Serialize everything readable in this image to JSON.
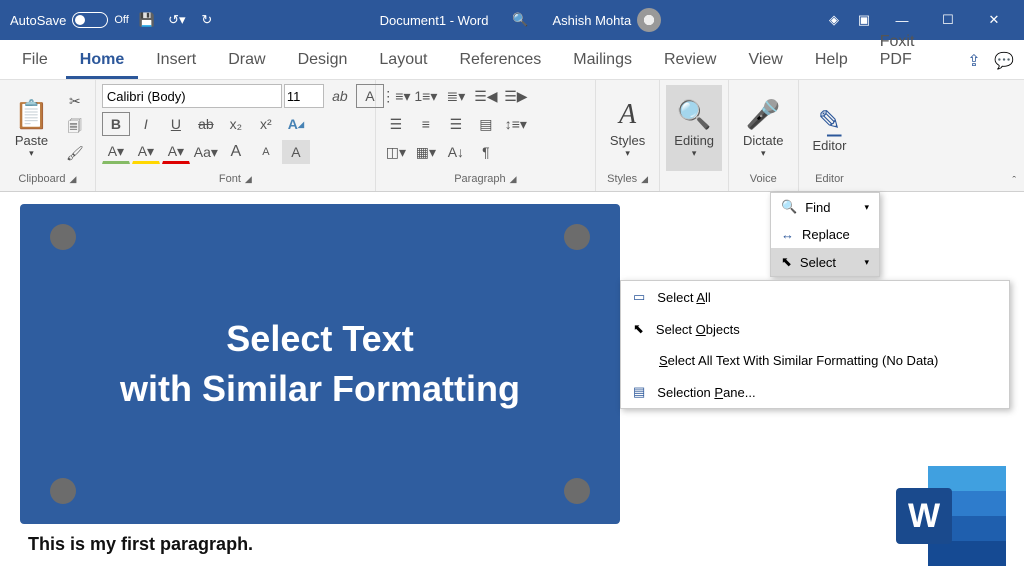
{
  "titlebar": {
    "autosave": "AutoSave",
    "autosave_state": "Off",
    "doc_title": "Document1 - Word",
    "username": "Ashish Mohta"
  },
  "tabs": {
    "items": [
      "File",
      "Home",
      "Insert",
      "Draw",
      "Design",
      "Layout",
      "References",
      "Mailings",
      "Review",
      "View",
      "Help",
      "Foxit PDF"
    ],
    "active": 1
  },
  "ribbon": {
    "clipboard": {
      "paste": "Paste",
      "label": "Clipboard"
    },
    "font": {
      "name": "Calibri (Body)",
      "size": "11",
      "label": "Font",
      "buttons_row2": [
        "B",
        "I",
        "U",
        "ab",
        "x₂",
        "x²",
        "FP"
      ],
      "buttons_row3": [
        "A",
        "A",
        "A",
        "Aa",
        "A",
        "A",
        "A"
      ]
    },
    "paragraph": {
      "label": "Paragraph"
    },
    "styles": {
      "btn": "Styles",
      "label": "Styles"
    },
    "editing": {
      "btn": "Editing"
    },
    "voice": {
      "btn": "Dictate",
      "label": "Voice"
    },
    "editor": {
      "btn": "Editor",
      "label": "Editor"
    }
  },
  "editing_menu": {
    "find": "Find",
    "replace": "Replace",
    "select": "Select"
  },
  "select_menu": {
    "select_all": "Select All",
    "select_objects": "Select Objects",
    "similar": "Select All Text With Similar Formatting (No Data)",
    "pane": "Selection Pane..."
  },
  "document": {
    "card_line1": "Select Text",
    "card_line2": "with Similar Formatting",
    "paragraph": "This is my first paragraph."
  },
  "wordlogo": "W"
}
